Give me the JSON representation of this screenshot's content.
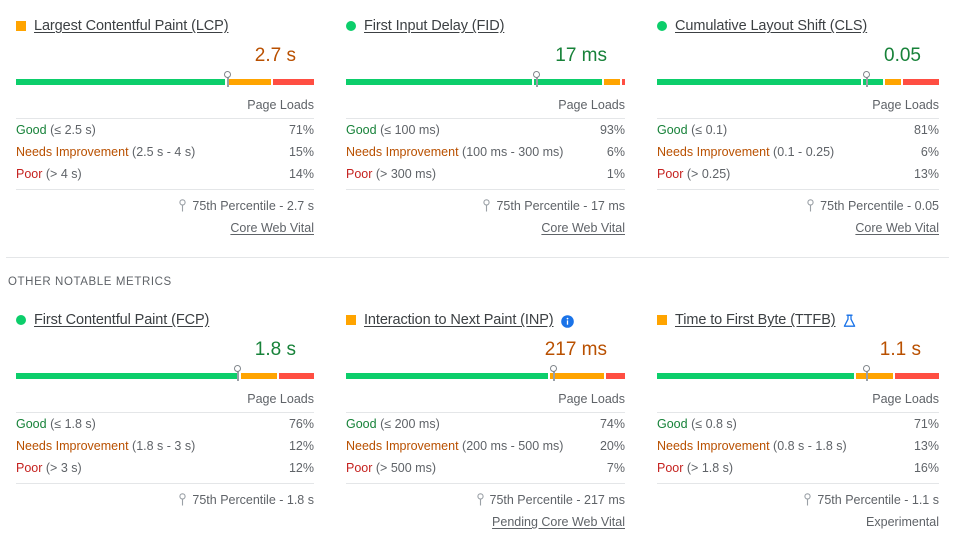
{
  "sections": [
    {
      "id": "core-web-vitals",
      "heading": "",
      "cards": [
        {
          "key": "lcp",
          "title": "Largest Contentful Paint (LCP)",
          "mark": "square-orange",
          "badge": "",
          "value": "2.7 s",
          "value_state": "ni",
          "marker_pct": 71,
          "loads_label": "Page Loads",
          "rows": [
            {
              "key": "Good",
              "state": "good",
              "range": "(≤ 2.5 s)",
              "pct": "71%",
              "value": 71
            },
            {
              "key": "Needs Improvement",
              "state": "ni",
              "range": "(2.5 s - 4 s)",
              "pct": "15%",
              "value": 15
            },
            {
              "key": "Poor",
              "state": "poor",
              "range": "(> 4 s)",
              "pct": "14%",
              "value": 14
            }
          ],
          "percentile": "75th Percentile - 2.7 s",
          "footer": "Core Web Vital",
          "footer_link": true
        },
        {
          "key": "fid",
          "title": "First Input Delay (FID)",
          "mark": "circle-green",
          "badge": "",
          "value": "17 ms",
          "value_state": "good",
          "marker_pct": 68,
          "loads_label": "Page Loads",
          "rows": [
            {
              "key": "Good",
              "state": "good",
              "range": "(≤ 100 ms)",
              "pct": "93%",
              "value": 93
            },
            {
              "key": "Needs Improvement",
              "state": "ni",
              "range": "(100 ms - 300 ms)",
              "pct": "6%",
              "value": 6
            },
            {
              "key": "Poor",
              "state": "poor",
              "range": "(> 300 ms)",
              "pct": "1%",
              "value": 1
            }
          ],
          "percentile": "75th Percentile - 17 ms",
          "footer": "Core Web Vital",
          "footer_link": true
        },
        {
          "key": "cls",
          "title": "Cumulative Layout Shift (CLS)",
          "mark": "circle-green",
          "badge": "",
          "value": "0.05",
          "value_state": "good",
          "marker_pct": 74,
          "loads_label": "Page Loads",
          "rows": [
            {
              "key": "Good",
              "state": "good",
              "range": "(≤ 0.1)",
              "pct": "81%",
              "value": 81
            },
            {
              "key": "Needs Improvement",
              "state": "ni",
              "range": "(0.1 - 0.25)",
              "pct": "6%",
              "value": 6
            },
            {
              "key": "Poor",
              "state": "poor",
              "range": "(> 0.25)",
              "pct": "13%",
              "value": 13
            }
          ],
          "percentile": "75th Percentile - 0.05",
          "footer": "Core Web Vital",
          "footer_link": true
        }
      ]
    },
    {
      "id": "other-notable-metrics",
      "heading": "OTHER NOTABLE METRICS",
      "cards": [
        {
          "key": "fcp",
          "title": "First Contentful Paint (FCP)",
          "mark": "circle-green",
          "badge": "",
          "value": "1.8 s",
          "value_state": "good",
          "marker_pct": 74,
          "loads_label": "Page Loads",
          "rows": [
            {
              "key": "Good",
              "state": "good",
              "range": "(≤ 1.8 s)",
              "pct": "76%",
              "value": 76
            },
            {
              "key": "Needs Improvement",
              "state": "ni",
              "range": "(1.8 s - 3 s)",
              "pct": "12%",
              "value": 12
            },
            {
              "key": "Poor",
              "state": "poor",
              "range": "(> 3 s)",
              "pct": "12%",
              "value": 12
            }
          ],
          "percentile": "75th Percentile - 1.8 s",
          "footer": "",
          "footer_link": false
        },
        {
          "key": "inp",
          "title": "Interaction to Next Paint (INP)",
          "mark": "square-orange",
          "badge": "info-icon",
          "value": "217 ms",
          "value_state": "ni",
          "marker_pct": 74,
          "loads_label": "Page Loads",
          "rows": [
            {
              "key": "Good",
              "state": "good",
              "range": "(≤ 200 ms)",
              "pct": "74%",
              "value": 74
            },
            {
              "key": "Needs Improvement",
              "state": "ni",
              "range": "(200 ms - 500 ms)",
              "pct": "20%",
              "value": 20
            },
            {
              "key": "Poor",
              "state": "poor",
              "range": "(> 500 ms)",
              "pct": "7%",
              "value": 7
            }
          ],
          "percentile": "75th Percentile - 217 ms",
          "footer": "Pending Core Web Vital",
          "footer_link": true
        },
        {
          "key": "ttfb",
          "title": "Time to First Byte (TTFB)",
          "mark": "square-orange",
          "badge": "flask-icon",
          "value": "1.1 s",
          "value_state": "ni",
          "marker_pct": 71,
          "loads_label": "Page Loads",
          "rows": [
            {
              "key": "Good",
              "state": "good",
              "range": "(≤ 0.8 s)",
              "pct": "71%",
              "value": 71
            },
            {
              "key": "Needs Improvement",
              "state": "ni",
              "range": "(0.8 s - 1.8 s)",
              "pct": "13%",
              "value": 13
            },
            {
              "key": "Poor",
              "state": "poor",
              "range": "(> 1.8 s)",
              "pct": "16%",
              "value": 16
            }
          ],
          "percentile": "75th Percentile - 1.1 s",
          "footer": "Experimental",
          "footer_link": false
        }
      ]
    }
  ],
  "colors": {
    "good": "#0cce6b",
    "needs_improvement": "#ffa400",
    "poor": "#ff4e42",
    "good_text": "#178239",
    "ni_text": "#b95000",
    "poor_text": "#c5221f",
    "muted_text": "#5f6368",
    "title_text": "#3c4043",
    "info_blue": "#1a73e8",
    "divider": "#e4e6e8"
  },
  "chart_data": {
    "type": "bar",
    "title": "Core Web Vitals and Other Notable Metrics — Page Loads distribution",
    "categories": [
      "Good",
      "Needs Improvement",
      "Poor"
    ],
    "unit": "% of Page Loads",
    "ylim": [
      0,
      100
    ],
    "grid": false,
    "legend": "none",
    "series": [
      {
        "name": "Largest Contentful Paint (LCP)",
        "values": [
          71,
          15,
          14
        ],
        "p75": "2.7 s"
      },
      {
        "name": "First Input Delay (FID)",
        "values": [
          93,
          6,
          1
        ],
        "p75": "17 ms"
      },
      {
        "name": "Cumulative Layout Shift (CLS)",
        "values": [
          81,
          6,
          13
        ],
        "p75": "0.05"
      },
      {
        "name": "First Contentful Paint (FCP)",
        "values": [
          76,
          12,
          12
        ],
        "p75": "1.8 s"
      },
      {
        "name": "Interaction to Next Paint (INP)",
        "values": [
          74,
          20,
          7
        ],
        "p75": "217 ms"
      },
      {
        "name": "Time to First Byte (TTFB)",
        "values": [
          71,
          13,
          16
        ],
        "p75": "1.1 s"
      }
    ]
  }
}
